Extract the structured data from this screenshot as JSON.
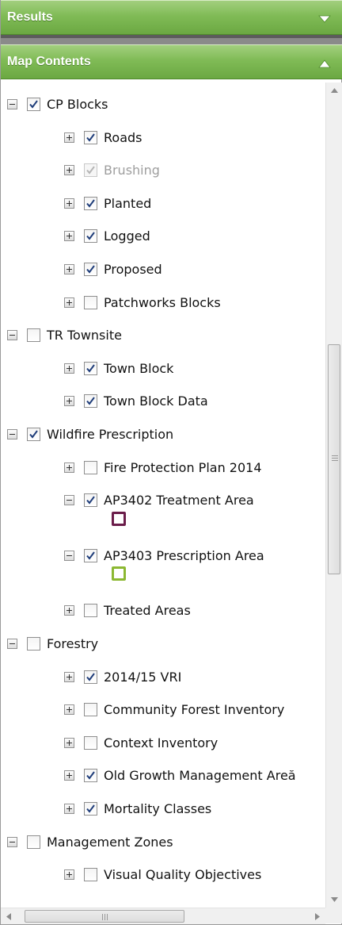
{
  "results_header": {
    "title": "Results",
    "state": "collapsed",
    "icon": "chevron-down-icon"
  },
  "map_contents_header": {
    "title": "Map Contents",
    "state": "expanded",
    "icon": "chevron-up-icon"
  },
  "layers": [
    {
      "id": "cp-blocks",
      "label": "CP Blocks",
      "level": 0,
      "expander": "minus",
      "checked": true,
      "disabled": false
    },
    {
      "id": "roads",
      "label": "Roads",
      "level": 1,
      "expander": "plus",
      "checked": true,
      "disabled": false
    },
    {
      "id": "brushing",
      "label": "Brushing",
      "level": 1,
      "expander": "plus",
      "checked": true,
      "disabled": true
    },
    {
      "id": "planted",
      "label": "Planted",
      "level": 1,
      "expander": "plus",
      "checked": true,
      "disabled": false
    },
    {
      "id": "logged",
      "label": "Logged",
      "level": 1,
      "expander": "plus",
      "checked": true,
      "disabled": false
    },
    {
      "id": "proposed",
      "label": "Proposed",
      "level": 1,
      "expander": "plus",
      "checked": true,
      "disabled": false
    },
    {
      "id": "patchworks-blocks",
      "label": "Patchworks Blocks",
      "level": 1,
      "expander": "plus",
      "checked": false,
      "disabled": false
    },
    {
      "id": "tr-townsite",
      "label": "TR Townsite",
      "level": 0,
      "expander": "minus",
      "checked": false,
      "disabled": false
    },
    {
      "id": "town-block",
      "label": "Town Block",
      "level": 1,
      "expander": "plus",
      "checked": true,
      "disabled": false
    },
    {
      "id": "town-block-data",
      "label": "Town Block Data",
      "level": 1,
      "expander": "plus",
      "checked": true,
      "disabled": false
    },
    {
      "id": "wildfire-prescription",
      "label": "Wildfire Prescription",
      "level": 0,
      "expander": "minus",
      "checked": true,
      "disabled": false
    },
    {
      "id": "fire-protection-plan-2014",
      "label": "Fire Protection Plan 2014",
      "level": 1,
      "expander": "plus",
      "checked": false,
      "disabled": false
    },
    {
      "id": "ap3402-treatment-area",
      "label": "AP3402 Treatment Area",
      "level": 1,
      "expander": "minus",
      "checked": true,
      "disabled": false,
      "legend_color": "#6b1d4a"
    },
    {
      "id": "ap3403-prescription-area",
      "label": "AP3403 Prescription Area",
      "level": 1,
      "expander": "minus",
      "checked": true,
      "disabled": false,
      "legend_color": "#8cb832"
    },
    {
      "id": "treated-areas",
      "label": "Treated Areas",
      "level": 1,
      "expander": "plus",
      "checked": false,
      "disabled": false
    },
    {
      "id": "forestry",
      "label": "Forestry",
      "level": 0,
      "expander": "minus",
      "checked": false,
      "disabled": false
    },
    {
      "id": "vri-2014-15",
      "label": "2014/15 VRI",
      "level": 1,
      "expander": "plus",
      "checked": true,
      "disabled": false
    },
    {
      "id": "community-forest-inventory",
      "label": "Community Forest Inventory",
      "level": 1,
      "expander": "plus",
      "checked": false,
      "disabled": false
    },
    {
      "id": "context-inventory",
      "label": "Context Inventory",
      "level": 1,
      "expander": "plus",
      "checked": false,
      "disabled": false
    },
    {
      "id": "old-growth-management-area",
      "label": "Old Growth Management Areă",
      "level": 1,
      "expander": "plus",
      "checked": true,
      "disabled": false
    },
    {
      "id": "mortality-classes",
      "label": "Mortality Classes",
      "level": 1,
      "expander": "plus",
      "checked": true,
      "disabled": false
    },
    {
      "id": "management-zones",
      "label": "Management Zones",
      "level": 0,
      "expander": "minus",
      "checked": false,
      "disabled": false
    },
    {
      "id": "visual-quality-objectives",
      "label": "Visual Quality Objectives",
      "level": 1,
      "expander": "plus",
      "checked": false,
      "disabled": false
    }
  ],
  "scrollbars": {
    "vertical": {
      "position": "mid",
      "icons": [
        "scroll-up-arrow-icon",
        "scroll-down-arrow-icon",
        "scroll-grip-icon"
      ]
    },
    "horizontal": {
      "position": "start",
      "icons": [
        "scroll-left-arrow-icon",
        "scroll-right-arrow-icon",
        "scroll-grip-icon"
      ]
    }
  }
}
